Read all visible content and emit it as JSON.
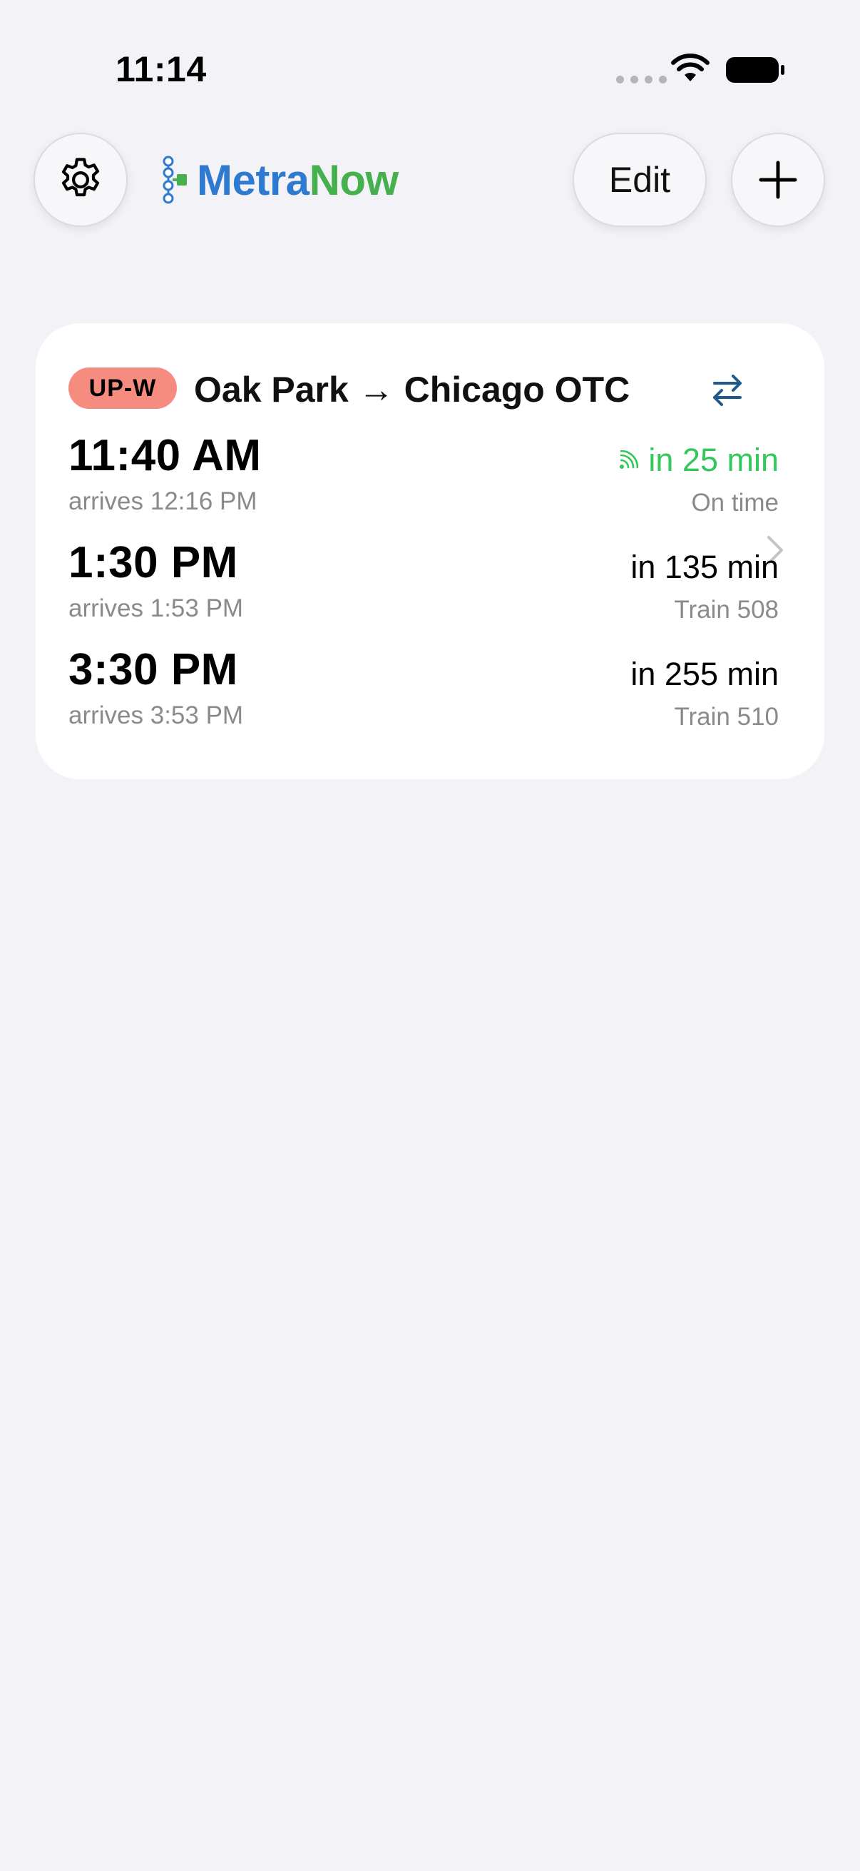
{
  "status_bar": {
    "time": "11:14"
  },
  "header": {
    "settings_icon": "gear-icon",
    "logo_part1": "Metra",
    "logo_part2": "Now",
    "edit_label": "Edit",
    "add_icon": "plus-icon"
  },
  "colors": {
    "background": "#f2f2f7",
    "card": "#ffffff",
    "brand_blue": "#2f7ad1",
    "brand_green": "#45b04d",
    "route_badge": "#f68b80",
    "live_green": "#34c759",
    "secondary_text": "#8a8a8e",
    "swap_icon": "#1e5a8c"
  },
  "card": {
    "route_badge": "UP-W",
    "route_title": "Oak Park → Chicago OTC",
    "swap_icon": "swap-arrows-icon",
    "chevron_icon": "chevron-right-icon",
    "trips": [
      {
        "depart": "11:40 AM",
        "arrive": "arrives 12:16 PM",
        "eta": "in 25 min",
        "status": "On time",
        "live": true
      },
      {
        "depart": "1:30 PM",
        "arrive": "arrives 1:53 PM",
        "eta": "in 135 min",
        "status": "Train 508",
        "live": false
      },
      {
        "depart": "3:30 PM",
        "arrive": "arrives 3:53 PM",
        "eta": "in 255 min",
        "status": "Train 510",
        "live": false
      }
    ]
  }
}
